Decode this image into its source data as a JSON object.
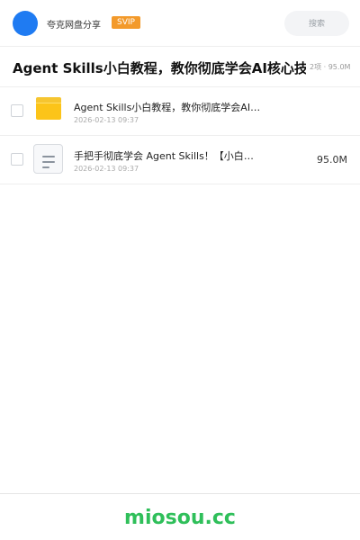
{
  "header": {
    "app_name": "夸克网盘分享",
    "badge": "SVIP",
    "search_placeholder": "搜索"
  },
  "share": {
    "title": "Agent Skills小白教程，教你彻底学会AI核心技能",
    "meta": "2项 · 95.0M"
  },
  "files": [
    {
      "type": "folder",
      "name": "Agent Skills小白教程，教你彻底学会AI核心技能",
      "date": "2026-02-13 09:37",
      "size": ""
    },
    {
      "type": "document",
      "name": "手把手彻底学会 Agent Skills！【小白教程】",
      "date": "2026-02-13 09:37",
      "size": "95.0M"
    }
  ],
  "footer": {
    "brand": "miosou.cc"
  },
  "colors": {
    "accent": "#1f7bf2",
    "badge": "#f39a2b",
    "folder": "#fcc419",
    "brand": "#2fbf5a"
  }
}
